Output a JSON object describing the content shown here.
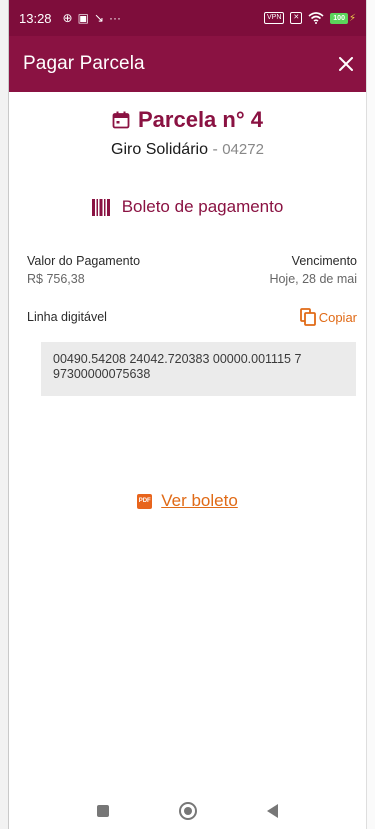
{
  "status_bar": {
    "time": "13:28",
    "left_icons": [
      "location-icon",
      "image-notification-icon",
      "missed-call-icon",
      "more-notifications-icon"
    ],
    "more_text": "···",
    "vpn_label": "VPN",
    "battery_level": "100"
  },
  "app_bar": {
    "title": "Pagar Parcela",
    "close_icon": "close-icon"
  },
  "parcela": {
    "title": "Parcela n° 4",
    "product": "Giro Solidário",
    "separator": "-",
    "code": "04272"
  },
  "boleto": {
    "section_title": "Boleto de pagamento",
    "valor_label": "Valor do Pagamento",
    "valor_value": "R$  756,38",
    "vencimento_label": "Vencimento",
    "vencimento_value": "Hoje,  28 de mai",
    "linha_label": "Linha digitável",
    "copy_label": "Copiar",
    "linha_value": "00490.54208 24042.720383 00000.001115 7 97300000075638",
    "ver_boleto_label": "Ver boleto",
    "pdf_badge": "PDF"
  },
  "colors": {
    "brand": "#8a1242",
    "status_bar": "#7e0d3b",
    "accent": "#e06a16",
    "code_box": "#ebebeb"
  }
}
